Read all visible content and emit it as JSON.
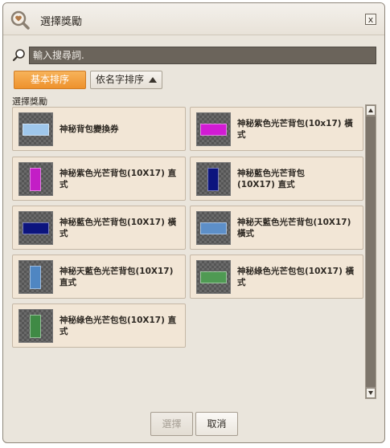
{
  "window": {
    "title": "選擇獎勵",
    "close_label": "x"
  },
  "search": {
    "placeholder": "輸入搜尋詞."
  },
  "sort": {
    "basic_label": "基本排序",
    "name_label": "依名字排序"
  },
  "section_label": "選擇獎勵",
  "items": [
    {
      "label": "神秘背包變換券",
      "color": "#9fc7ec",
      "shape": "horizontal"
    },
    {
      "label": "神秘紫色光芒背包(10x17) 橫式",
      "color": "#d21bd4",
      "shape": "horizontal"
    },
    {
      "label": "神秘紫色光芒背包(10X17) 直式",
      "color": "#c31ec6",
      "shape": "vertical"
    },
    {
      "label": "神秘藍色光芒背包\n(10X17) 直式",
      "color": "#0c147e",
      "shape": "vertical"
    },
    {
      "label": "神秘藍色光芒背包(10X17) 橫式",
      "color": "#0c147e",
      "shape": "horizontal"
    },
    {
      "label": "神秘天藍色光芒背包(10X17) 橫式",
      "color": "#5d8fc8",
      "shape": "horizontal"
    },
    {
      "label": "神秘天藍色光芒背包(10X17) 直式",
      "color": "#4f86c2",
      "shape": "vertical"
    },
    {
      "label": "神秘綠色光芒包包(10X17) 橫式",
      "color": "#4f9a53",
      "shape": "horizontal"
    },
    {
      "label": "神秘綠色光芒包包(10X17) 直式",
      "color": "#3f8a45",
      "shape": "vertical"
    }
  ],
  "buttons": {
    "select_label": "選擇",
    "cancel_label": "取消"
  }
}
